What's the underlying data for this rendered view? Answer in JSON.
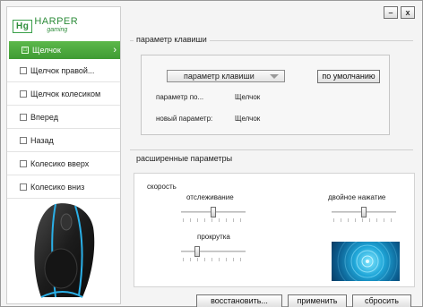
{
  "logo": {
    "box": "Hg",
    "brand": "HARPER",
    "sub": "gaming"
  },
  "sidebar": {
    "items": [
      {
        "label": "Щелчок",
        "active": true
      },
      {
        "label": "Щелчок правой..."
      },
      {
        "label": "Щелчок колесиком"
      },
      {
        "label": "Вперед"
      },
      {
        "label": "Назад"
      },
      {
        "label": "Колесико вверх"
      },
      {
        "label": "Колесико вниз"
      }
    ]
  },
  "window": {
    "minimize": "–",
    "close": "x"
  },
  "key_param": {
    "group_title": "параметр клавиши",
    "dropdown_value": "параметр клавиши",
    "default_button": "по умолчанию",
    "current_label": "параметр по...",
    "current_value": "Щелчок",
    "new_label": "новый параметр:",
    "new_value": "Щелчок"
  },
  "advanced": {
    "group_title": "расширенные параметры",
    "speed_label": "скорость",
    "tracking_label": "отслеживание",
    "double_click_label": "двойное нажатие",
    "scroll_label": "прокрутка",
    "tracking_level": 0.5,
    "double_click_level": 0.5,
    "scroll_level": 0.25
  },
  "footer": {
    "restore": "восстановить...",
    "apply": "применить",
    "reset": "сбросить"
  },
  "colors": {
    "accent": "#4aa83c",
    "preview": "#1fa6d8"
  }
}
